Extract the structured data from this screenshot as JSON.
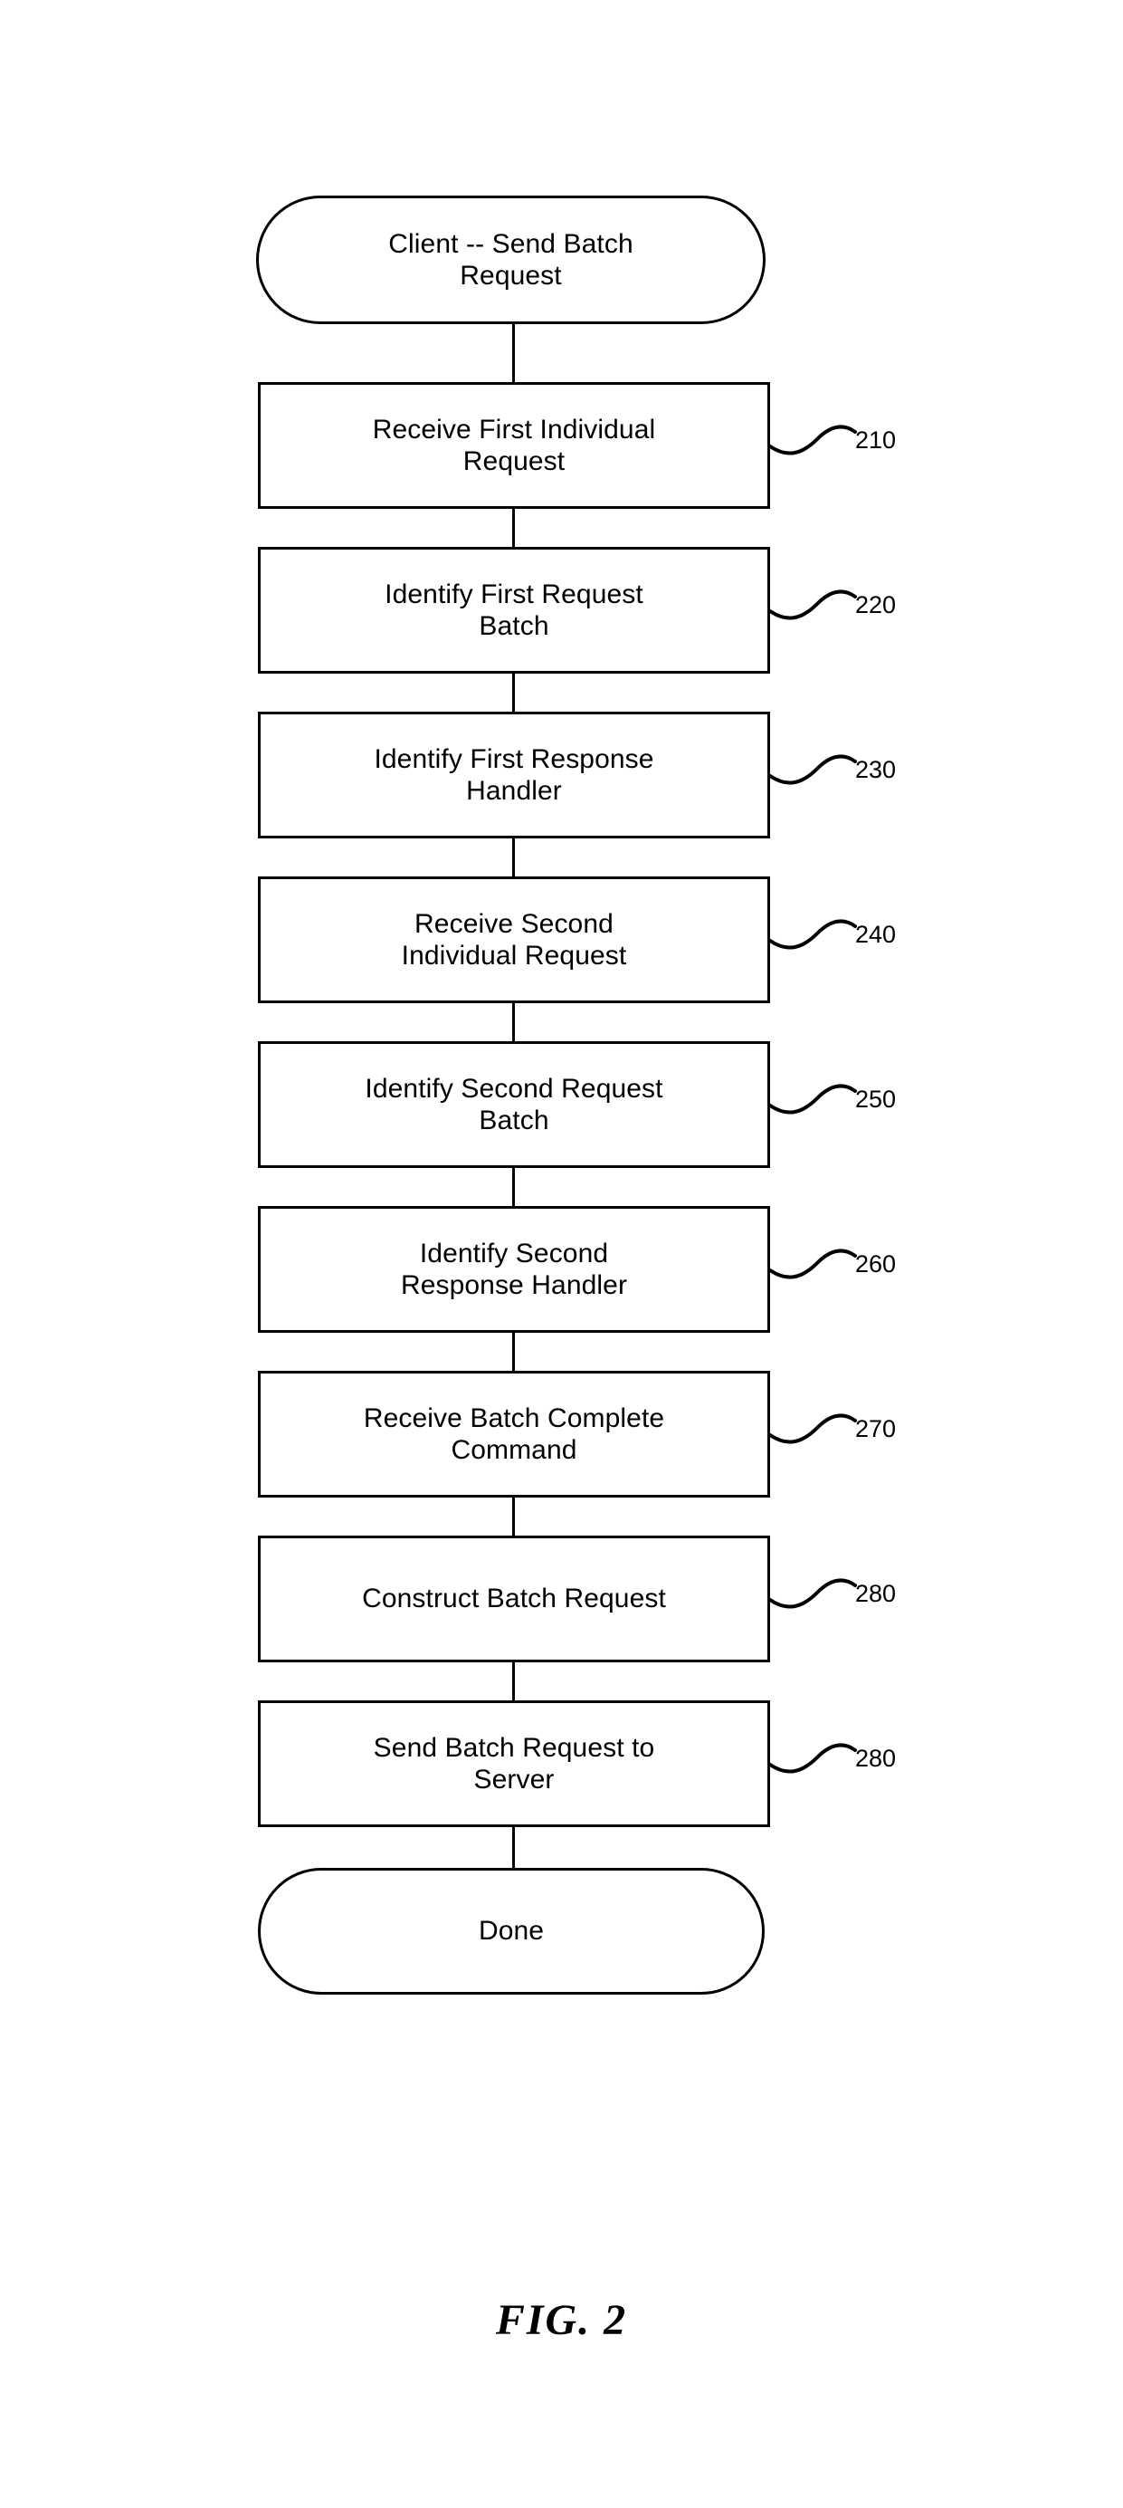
{
  "figure": {
    "caption": "FIG. 2",
    "title": "Client -- Send Batch Request"
  },
  "diagram": {
    "type": "flowchart",
    "orientation": "vertical",
    "line_color": "#000000",
    "fill_color": "#ffffff",
    "nodes": [
      {
        "id": "start",
        "shape": "terminal",
        "label": "Client -- Send Batch\nRequest",
        "ref": null
      },
      {
        "id": "step-210",
        "shape": "process",
        "label": "Receive First Individual\nRequest",
        "ref": "210"
      },
      {
        "id": "step-220",
        "shape": "process",
        "label": "Identify First Request\nBatch",
        "ref": "220"
      },
      {
        "id": "step-230",
        "shape": "process",
        "label": "Identify First Response\nHandler",
        "ref": "230"
      },
      {
        "id": "step-240",
        "shape": "process",
        "label": "Receive Second\nIndividual Request",
        "ref": "240"
      },
      {
        "id": "step-250",
        "shape": "process",
        "label": "Identify Second Request\nBatch",
        "ref": "250"
      },
      {
        "id": "step-260",
        "shape": "process",
        "label": "Identify Second\nResponse Handler",
        "ref": "260"
      },
      {
        "id": "step-270",
        "shape": "process",
        "label": "Receive Batch Complete\nCommand",
        "ref": "270"
      },
      {
        "id": "step-280a",
        "shape": "process",
        "label": "Construct Batch Request",
        "ref": "280"
      },
      {
        "id": "step-280b",
        "shape": "process",
        "label": "Send Batch Request to\nServer",
        "ref": "280"
      },
      {
        "id": "end",
        "shape": "terminal",
        "label": "Done",
        "ref": null
      }
    ]
  }
}
